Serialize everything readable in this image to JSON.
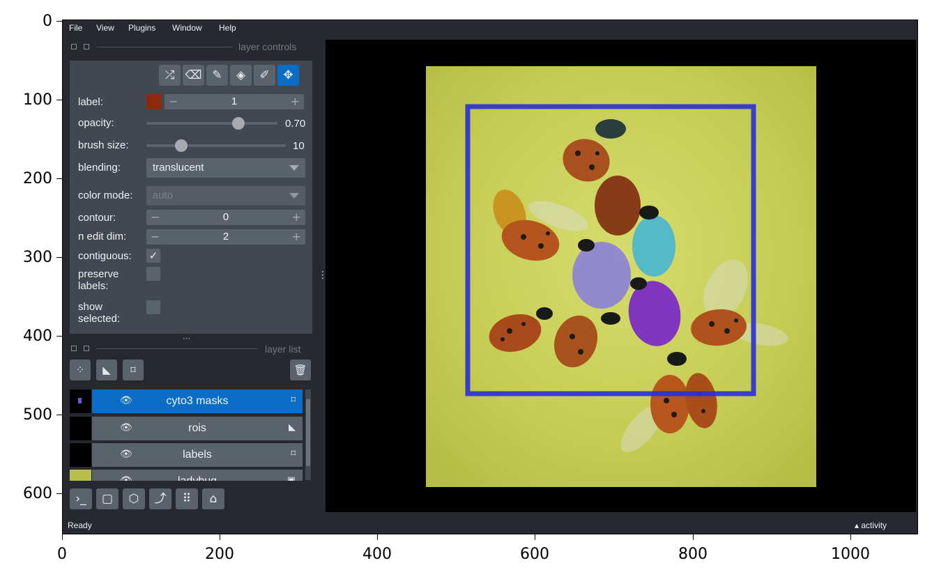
{
  "plot": {
    "y_ticks": [
      "0",
      "100",
      "200",
      "300",
      "400",
      "500",
      "600"
    ],
    "x_ticks": [
      "0",
      "200",
      "400",
      "600",
      "800",
      "1000"
    ]
  },
  "menubar": {
    "items": [
      "File",
      "View",
      "Plugins",
      "Window",
      "Help"
    ]
  },
  "layer_controls": {
    "title": "layer controls",
    "tools": [
      {
        "name": "shuffle-colors-icon",
        "glyph": "⤮",
        "active": false
      },
      {
        "name": "eraser-icon",
        "glyph": "⌫",
        "active": false
      },
      {
        "name": "paint-brush-icon",
        "glyph": "✎",
        "active": false
      },
      {
        "name": "fill-bucket-icon",
        "glyph": "◈",
        "active": false
      },
      {
        "name": "color-picker-icon",
        "glyph": "✐",
        "active": false
      },
      {
        "name": "pan-zoom-icon",
        "glyph": "✥",
        "active": true
      }
    ],
    "label_label": "label:",
    "label_value": "1",
    "label_color": "#8b2a0d",
    "opacity_label": "opacity:",
    "opacity_value": "0.70",
    "opacity_fraction": 0.7,
    "brush_size_label": "brush size:",
    "brush_size_value": "10",
    "brush_fraction": 0.25,
    "blending_label": "blending:",
    "blending_value": "translucent",
    "color_mode_label": "color mode:",
    "color_mode_value": "auto",
    "contour_label": "contour:",
    "contour_value": "0",
    "n_edit_dim_label": "n edit dim:",
    "n_edit_dim_value": "2",
    "contiguous_label": "contiguous:",
    "contiguous_checked": true,
    "preserve_labels_label": "preserve\nlabels:",
    "show_selected_label": "show\nselected:",
    "minus": "−",
    "plus": "+"
  },
  "layer_list": {
    "title": "layer list",
    "layers": [
      {
        "name": "cyto3 masks",
        "type_icon": "tag-icon",
        "selected": true
      },
      {
        "name": "rois",
        "type_icon": "shape-icon",
        "selected": false
      },
      {
        "name": "labels",
        "type_icon": "tag-icon",
        "selected": false
      },
      {
        "name": "ladybug",
        "type_icon": "image-icon",
        "selected": false
      }
    ],
    "eye_glyph": "👁"
  },
  "status": {
    "left": "Ready",
    "right": "▴ activity"
  },
  "colors": {
    "accent": "#0a6ec6",
    "panel": "#414851",
    "background": "#262930",
    "roi_box": "#2a2fd6",
    "image_bg": "#c7cf55"
  }
}
